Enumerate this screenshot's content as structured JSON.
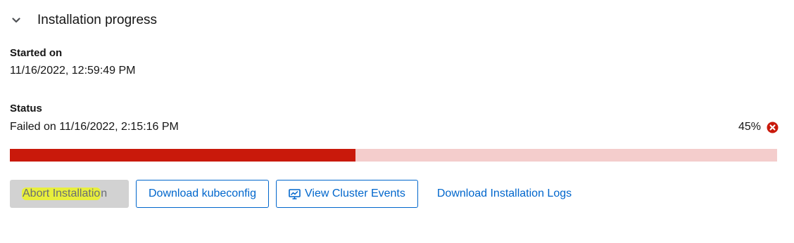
{
  "section": {
    "title": "Installation progress",
    "toggle_icon": "chevron-down-icon"
  },
  "started": {
    "label": "Started on",
    "value": "11/16/2022, 12:59:49 PM"
  },
  "status": {
    "label": "Status",
    "value": "Failed on 11/16/2022, 2:15:16 PM",
    "percent_text": "45%",
    "percent": 45,
    "state_icon": "error-circle-icon",
    "colors": {
      "danger": "#c9190b",
      "track": "#f4cdcc"
    }
  },
  "actions": {
    "abort_highlighted": "Abort Installatio",
    "abort_tail": "n",
    "download_kubeconfig": "Download kubeconfig",
    "view_events": "View Cluster Events",
    "view_events_icon": "monitor-chart-icon",
    "download_logs": "Download Installation Logs"
  },
  "colors": {
    "primary": "#0066cc",
    "disabled_bg": "#d2d2d2",
    "highlight": "#e8ef3c"
  }
}
